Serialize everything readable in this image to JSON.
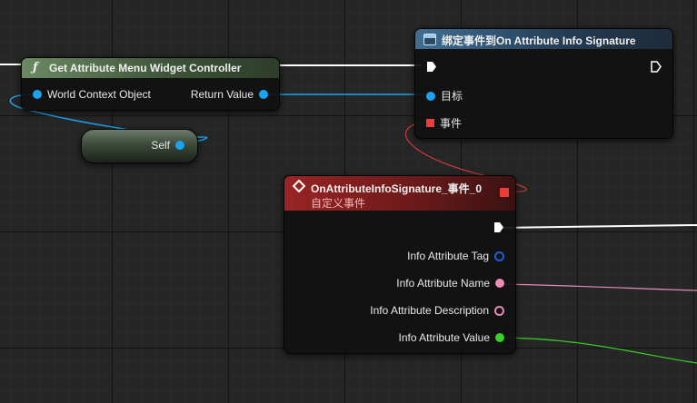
{
  "colors": {
    "background": "#262626",
    "object_pin": "#1aa3ef",
    "delegate_pin": "#ee3b3b",
    "struct_pin_tag": "#1c5fd8",
    "string_pin": "#f08ab7",
    "text_pin": "#e48ab8",
    "float_pin": "#38d126",
    "exec_pin": "#ffffff"
  },
  "get_controller_node": {
    "icon": "function-icon",
    "icon_glyph": "ƒ",
    "title": "Get Attribute Menu Widget Controller",
    "input_label": "World Context Object",
    "output_label": "Return Value"
  },
  "self_node": {
    "label": "Self"
  },
  "bind_node": {
    "icon": "bind-event-icon",
    "title": "绑定事件到On Attribute Info Signature",
    "target_label": "目标",
    "event_label": "事件"
  },
  "custom_event_node": {
    "icon": "event-diamond-icon",
    "title": "OnAttributeInfoSignature_事件_0",
    "subtitle": "自定义事件",
    "pins": [
      {
        "label": "Info Attribute Tag",
        "type": "struct"
      },
      {
        "label": "Info Attribute Name",
        "type": "string"
      },
      {
        "label": "Info Attribute Description",
        "type": "text"
      },
      {
        "label": "Info Attribute Value",
        "type": "float"
      }
    ]
  }
}
